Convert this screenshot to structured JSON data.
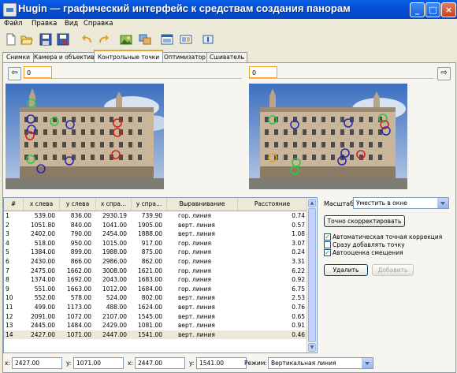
{
  "window": {
    "title": "Hugin — графический интерфейс к средствам создания панорам"
  },
  "menu": [
    "Файл",
    "Правка",
    "Вид",
    "Справка"
  ],
  "tabs": [
    "Снимки",
    "Камера и объектив",
    "Контрольные точки",
    "Оптимизатор",
    "Сшиватель"
  ],
  "left_image": {
    "number": "0"
  },
  "right_image": {
    "number": "0"
  },
  "table": {
    "headers": [
      "#",
      "x слева",
      "y слева",
      "x спра...",
      "y спра...",
      "Выравнивание",
      "Расстояние"
    ],
    "rows": [
      [
        "1",
        "539.00",
        "836.00",
        "2930.19",
        "739.90",
        "гор. линия",
        "0.74"
      ],
      [
        "2",
        "1051.80",
        "840.00",
        "1041.00",
        "1905.00",
        "верт. линия",
        "0.57"
      ],
      [
        "3",
        "2402.00",
        "790.00",
        "2454.00",
        "1888.00",
        "верт. линия",
        "1.08"
      ],
      [
        "4",
        "518.00",
        "950.00",
        "1015.00",
        "917.00",
        "гор. линия",
        "3.07"
      ],
      [
        "5",
        "1384.00",
        "899.00",
        "1988.00",
        "875.00",
        "гор. линия",
        "0.24"
      ],
      [
        "6",
        "2430.00",
        "866.00",
        "2986.00",
        "862.00",
        "гор. линия",
        "3.31"
      ],
      [
        "7",
        "2475.00",
        "1662.00",
        "3008.00",
        "1621.00",
        "гор. линия",
        "6.22"
      ],
      [
        "8",
        "1374.00",
        "1692.00",
        "2043.00",
        "1683.00",
        "гор. линия",
        "0.92"
      ],
      [
        "9",
        "551.00",
        "1663.00",
        "1012.00",
        "1684.00",
        "гор. линия",
        "6.75"
      ],
      [
        "10",
        "552.00",
        "578.00",
        "524.00",
        "802.00",
        "верт. линия",
        "2.53"
      ],
      [
        "11",
        "499.00",
        "1173.00",
        "488.00",
        "1624.00",
        "верт. линия",
        "0.76"
      ],
      [
        "12",
        "2091.00",
        "1072.00",
        "2107.00",
        "1545.00",
        "верт. линия",
        "0.65"
      ],
      [
        "13",
        "2445.00",
        "1484.00",
        "2429.00",
        "1081.00",
        "верт. линия",
        "0.91"
      ],
      [
        "14",
        "2427.00",
        "1071.00",
        "2447.00",
        "1541.00",
        "верт. линия",
        "0.46"
      ]
    ]
  },
  "right_panel": {
    "scale_label": "Масштаб:",
    "scale_value": "Уместить в окне",
    "fine_tune_button": "Точно скорректировать",
    "auto_fine_tune_label": "Автоматическая точная коррекция",
    "auto_fine_tune_checked": true,
    "add_point_label": "Сразу добавлять точку",
    "add_point_checked": false,
    "auto_shift_label": "Автооценка смещения",
    "auto_shift_checked": true,
    "delete_button": "Удалить",
    "add_button": "Добавить"
  },
  "bottom": {
    "x1_label": "x:",
    "x1_value": "2427.00",
    "y1_label": "y:",
    "y1_value": "1071.00",
    "x2_label": "x:",
    "x2_value": "2447.00",
    "y2_label": "y:",
    "y2_value": "1541.00",
    "mode_label": "Режим:",
    "mode_value": "Вертикальная линия"
  },
  "icons": [
    "new-project-icon",
    "open-icon",
    "save-icon",
    "save-as-icon",
    "undo-icon",
    "redo-icon",
    "load-images-icon",
    "align-icon",
    "preview-icon",
    "fast-preview-icon",
    "info-icon"
  ]
}
